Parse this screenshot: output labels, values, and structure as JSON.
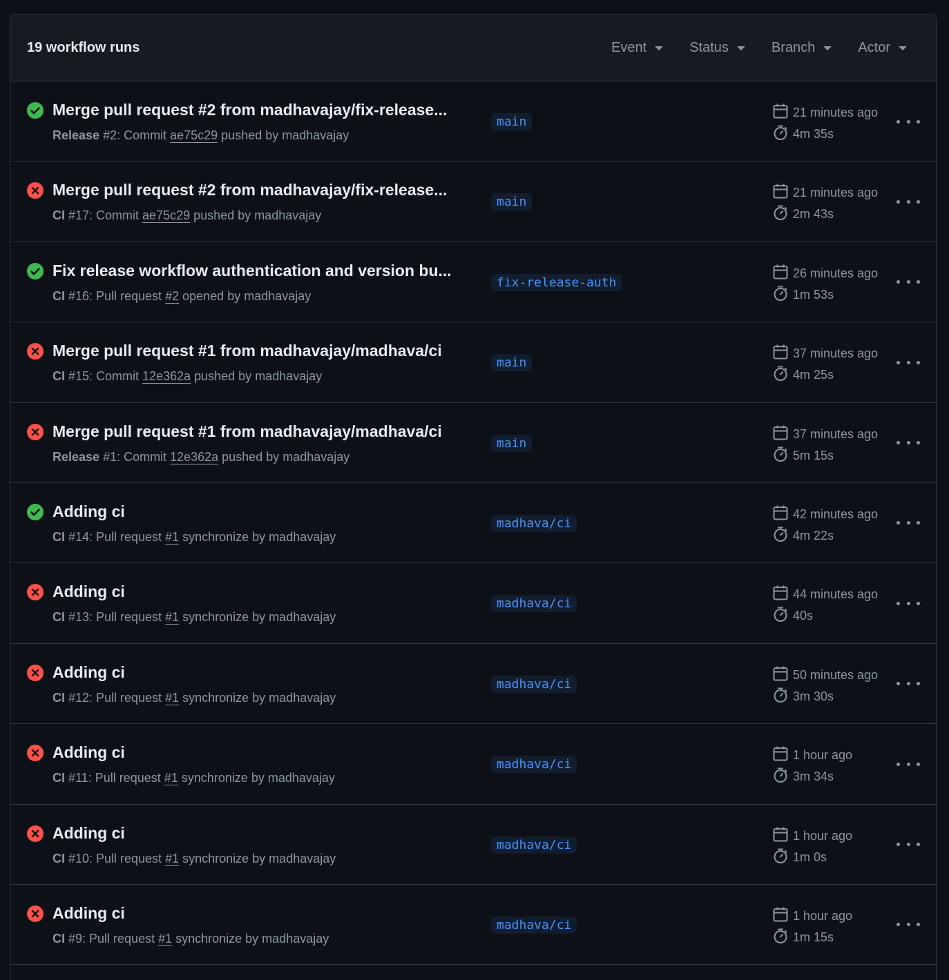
{
  "header": {
    "run_count": "19 workflow runs",
    "filters": [
      {
        "label": "Event"
      },
      {
        "label": "Status"
      },
      {
        "label": "Branch"
      },
      {
        "label": "Actor"
      }
    ]
  },
  "colors": {
    "success": "#3fb950",
    "failure": "#f85149",
    "branch_text": "#4493f8"
  },
  "runs": [
    {
      "status": "success",
      "title": "Merge pull request #2 from madhavajay/fix-release...",
      "workflow": "Release",
      "number": " #2: Commit ",
      "ref": "ae75c29",
      "tail": " pushed by madhavajay",
      "branch": "main",
      "when": "21 minutes ago",
      "duration": "4m 35s"
    },
    {
      "status": "failure",
      "title": "Merge pull request #2 from madhavajay/fix-release...",
      "workflow": "CI",
      "number": " #17: Commit ",
      "ref": "ae75c29",
      "tail": " pushed by madhavajay",
      "branch": "main",
      "when": "21 minutes ago",
      "duration": "2m 43s"
    },
    {
      "status": "success",
      "title": "Fix release workflow authentication and version bu...",
      "workflow": "CI",
      "number": " #16: Pull request ",
      "ref": "#2",
      "tail": " opened by madhavajay",
      "branch": "fix-release-auth",
      "when": "26 minutes ago",
      "duration": "1m 53s"
    },
    {
      "status": "failure",
      "title": "Merge pull request #1 from madhavajay/madhava/ci",
      "workflow": "CI",
      "number": " #15: Commit ",
      "ref": "12e362a",
      "tail": " pushed by madhavajay",
      "branch": "main",
      "when": "37 minutes ago",
      "duration": "4m 25s"
    },
    {
      "status": "failure",
      "title": "Merge pull request #1 from madhavajay/madhava/ci",
      "workflow": "Release",
      "number": " #1: Commit ",
      "ref": "12e362a",
      "tail": " pushed by madhavajay",
      "branch": "main",
      "when": "37 minutes ago",
      "duration": "5m 15s"
    },
    {
      "status": "success",
      "title": "Adding ci",
      "workflow": "CI",
      "number": " #14: Pull request ",
      "ref": "#1",
      "tail": " synchronize by madhavajay",
      "branch": "madhava/ci",
      "when": "42 minutes ago",
      "duration": "4m 22s"
    },
    {
      "status": "failure",
      "title": "Adding ci",
      "workflow": "CI",
      "number": " #13: Pull request ",
      "ref": "#1",
      "tail": " synchronize by madhavajay",
      "branch": "madhava/ci",
      "when": "44 minutes ago",
      "duration": "40s"
    },
    {
      "status": "failure",
      "title": "Adding ci",
      "workflow": "CI",
      "number": " #12: Pull request ",
      "ref": "#1",
      "tail": " synchronize by madhavajay",
      "branch": "madhava/ci",
      "when": "50 minutes ago",
      "duration": "3m 30s"
    },
    {
      "status": "failure",
      "title": "Adding ci",
      "workflow": "CI",
      "number": " #11: Pull request ",
      "ref": "#1",
      "tail": " synchronize by madhavajay",
      "branch": "madhava/ci",
      "when": "1 hour ago",
      "duration": "3m 34s"
    },
    {
      "status": "failure",
      "title": "Adding ci",
      "workflow": "CI",
      "number": " #10: Pull request ",
      "ref": "#1",
      "tail": " synchronize by madhavajay",
      "branch": "madhava/ci",
      "when": "1 hour ago",
      "duration": "1m 0s"
    },
    {
      "status": "failure",
      "title": "Adding ci",
      "workflow": "CI",
      "number": " #9: Pull request ",
      "ref": "#1",
      "tail": " synchronize by madhavajay",
      "branch": "madhava/ci",
      "when": "1 hour ago",
      "duration": "1m 15s"
    }
  ]
}
